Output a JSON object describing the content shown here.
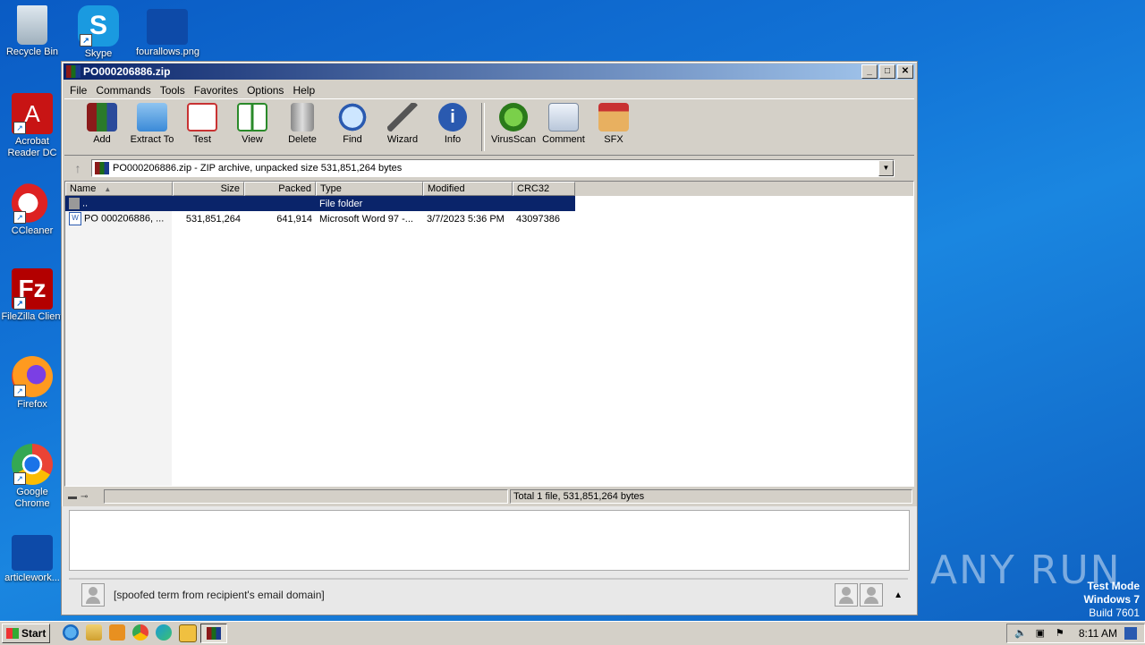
{
  "desktop": {
    "icons": [
      {
        "label": "Recycle Bin"
      },
      {
        "label": "Skype"
      },
      {
        "label": "fourallows.png"
      },
      {
        "label": "Acrobat Reader DC"
      },
      {
        "label": "CCleaner"
      },
      {
        "label": "FileZilla Client"
      },
      {
        "label": "Firefox"
      },
      {
        "label": "Google Chrome"
      },
      {
        "label": "articlework..."
      }
    ],
    "watermark": "ANY RUN",
    "test_mode": {
      "line1": "Test Mode",
      "line2": "Windows 7",
      "line3": "Build 7601"
    }
  },
  "window": {
    "title": "PO000206886.zip",
    "menu": [
      "File",
      "Commands",
      "Tools",
      "Favorites",
      "Options",
      "Help"
    ],
    "toolbar": [
      "Add",
      "Extract To",
      "Test",
      "View",
      "Delete",
      "Find",
      "Wizard",
      "Info",
      "VirusScan",
      "Comment",
      "SFX"
    ],
    "address": "PO000206886.zip - ZIP archive, unpacked size 531,851,264 bytes",
    "columns": {
      "name": "Name",
      "size": "Size",
      "packed": "Packed",
      "type": "Type",
      "modified": "Modified",
      "crc": "CRC32"
    },
    "rows": [
      {
        "name": "..",
        "size": "",
        "packed": "",
        "type": "File folder",
        "modified": "",
        "crc": ""
      },
      {
        "name": "PO 000206886, ...",
        "size": "531,851,264",
        "packed": "641,914",
        "type": "Microsoft Word 97 -...",
        "modified": "3/7/2023 5:36 PM",
        "crc": "43097386"
      }
    ],
    "status": "Total 1 file, 531,851,264 bytes"
  },
  "mail": {
    "sender": "[spoofed term from recipient's email domain]"
  },
  "taskbar": {
    "start": "Start",
    "clock": "8:11 AM"
  }
}
